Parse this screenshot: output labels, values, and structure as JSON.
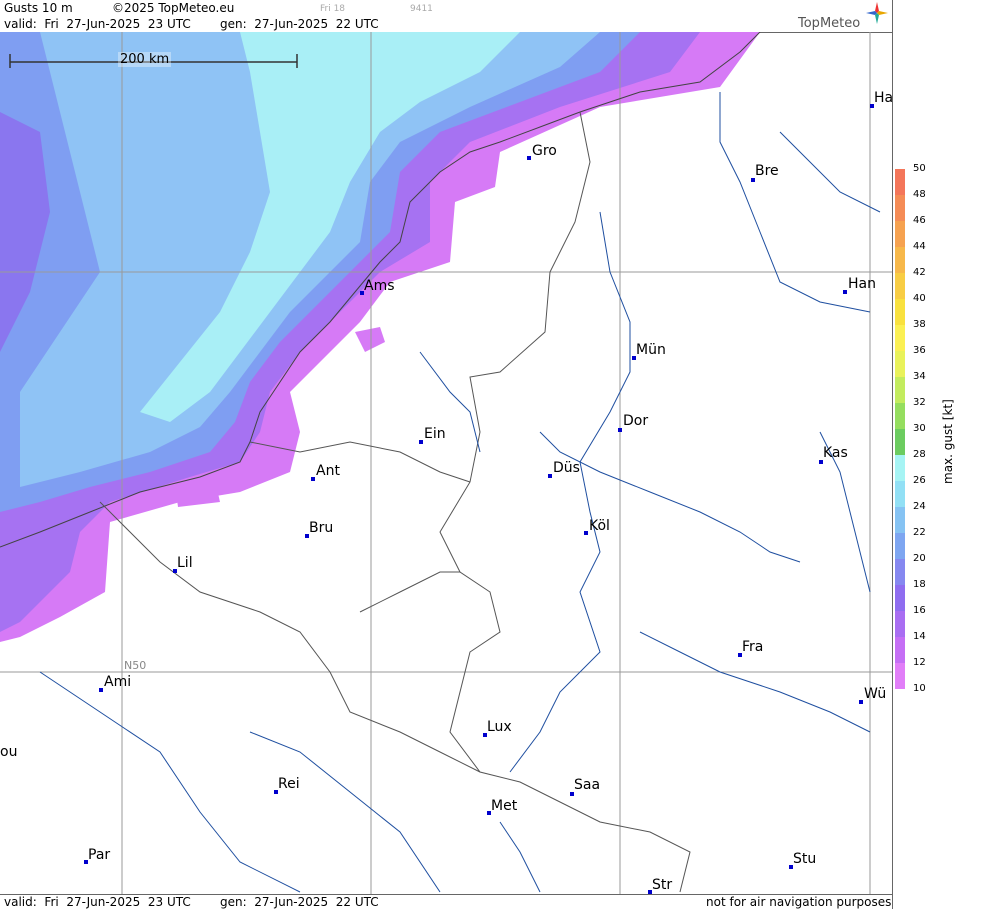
{
  "header": {
    "product": "Gusts 10 m",
    "copyright": "©2025 TopMeteo.eu",
    "day_marker": "Fri 18",
    "code": "9411",
    "valid": "valid:  Fri  27-Jun-2025  23 UTC",
    "gen": "gen:  27-Jun-2025  22 UTC",
    "brand": "TopMeteo"
  },
  "footer": {
    "valid": "valid:  Fri  27-Jun-2025  23 UTC",
    "gen": "gen:  27-Jun-2025  22 UTC",
    "disclaimer": "not for air navigation purposes"
  },
  "map": {
    "scale_label": "200 km",
    "latitude_label": "N50",
    "cities": [
      "Ha",
      "Gro",
      "Bre",
      "Ams",
      "Han",
      "Mün",
      "Dor",
      "Ein",
      "Kas",
      "Düs",
      "Ant",
      "Köl",
      "Bru",
      "Lil",
      "Fra",
      "Ami",
      "Wü",
      "Lux",
      "ou",
      "Rei",
      "Saa",
      "Met",
      "Par",
      "Stu",
      "Str"
    ]
  },
  "legend": {
    "title": "max. gust [kt]",
    "ticks": [
      "50",
      "48",
      "46",
      "44",
      "42",
      "40",
      "38",
      "36",
      "34",
      "32",
      "30",
      "28",
      "26",
      "24",
      "22",
      "20",
      "18",
      "16",
      "14",
      "12",
      "10"
    ],
    "colors": [
      "#f4765a",
      "#f58c56",
      "#f6a250",
      "#f7b84a",
      "#f8cd44",
      "#f9e13e",
      "#fbf053",
      "#e9f25a",
      "#c3ec5e",
      "#95de5f",
      "#6ccc60",
      "#a6f4f4",
      "#92e0f5",
      "#86c3f3",
      "#7ea6f1",
      "#8688f0",
      "#8f6df0",
      "#a96ef2",
      "#c56ff5",
      "#e17ef8"
    ]
  },
  "colors": {
    "strong_purple": "#a070f0",
    "blue": "#7e9cf2",
    "light_blue": "#8cc6f5",
    "cyan": "#a8f0f6",
    "magenta": "#d878f8",
    "border": "#666666",
    "river": "#1f4fa0",
    "city_dot": "#0000cc"
  }
}
